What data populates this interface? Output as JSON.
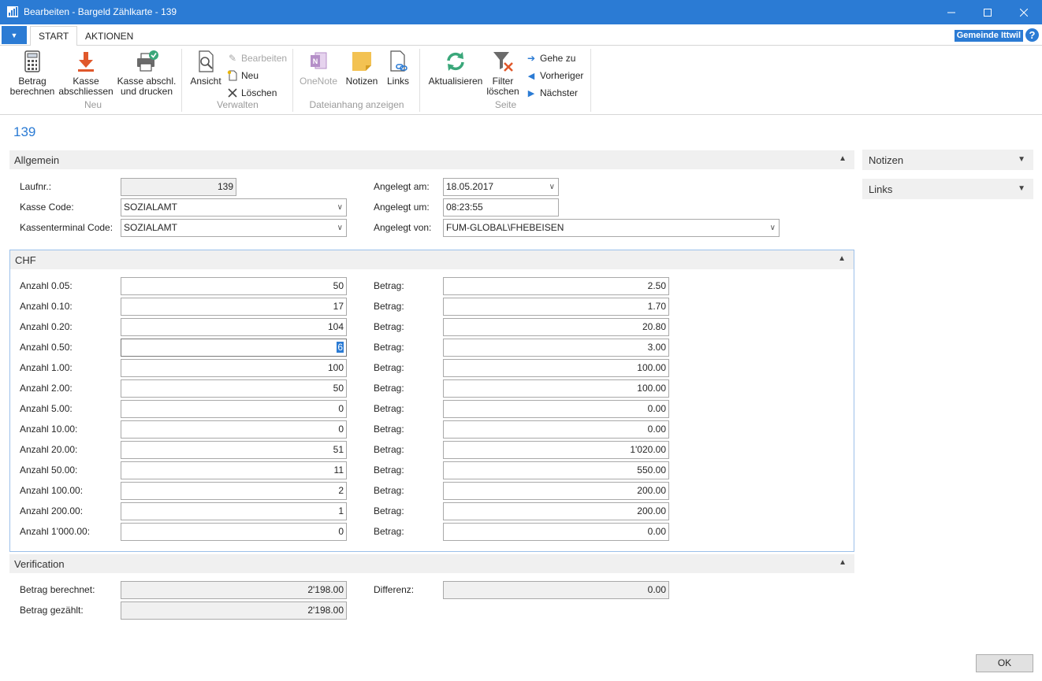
{
  "window": {
    "title": "Bearbeiten - Bargeld Zählkarte - 139"
  },
  "ribbon": {
    "tabs": [
      "START",
      "AKTIONEN"
    ],
    "company": "Gemeinde Ittwil",
    "groups": {
      "neu": {
        "label": "Neu",
        "betrag_berechnen": [
          "Betrag",
          "berechnen"
        ],
        "kasse_abschliessen": [
          "Kasse",
          "abschliessen"
        ],
        "kasse_drucken": [
          "Kasse abschl.",
          "und drucken"
        ]
      },
      "verwalten": {
        "label": "Verwalten",
        "ansicht": "Ansicht",
        "bearbeiten": "Bearbeiten",
        "neu": "Neu",
        "loeschen": "Löschen"
      },
      "dateianhang": {
        "label": "Dateianhang anzeigen",
        "onenote": "OneNote",
        "notizen": "Notizen",
        "links": "Links"
      },
      "seite": {
        "label": "Seite",
        "aktualisieren": "Aktualisieren",
        "filter_loeschen": [
          "Filter",
          "löschen"
        ],
        "gehe_zu": "Gehe zu",
        "vorheriger": "Vorheriger",
        "naechster": "Nächster"
      }
    }
  },
  "page": {
    "title": "139"
  },
  "allgemein": {
    "header": "Allgemein",
    "laufnr_label": "Laufnr.:",
    "laufnr": "139",
    "kasse_code_label": "Kasse Code:",
    "kasse_code": "SOZIALAMT",
    "kassenterminal_label": "Kassenterminal Code:",
    "kassenterminal": "SOZIALAMT",
    "angelegt_am_label": "Angelegt am:",
    "angelegt_am": "18.05.2017",
    "angelegt_um_label": "Angelegt um:",
    "angelegt_um": "08:23:55",
    "angelegt_von_label": "Angelegt von:",
    "angelegt_von": "FUM-GLOBAL\\FHEBEISEN"
  },
  "chf": {
    "header": "CHF",
    "betrag_label": "Betrag:",
    "rows": [
      {
        "label": "Anzahl 0.05:",
        "anzahl": "50",
        "betrag": "2.50"
      },
      {
        "label": "Anzahl 0.10:",
        "anzahl": "17",
        "betrag": "1.70"
      },
      {
        "label": "Anzahl 0.20:",
        "anzahl": "104",
        "betrag": "20.80"
      },
      {
        "label": "Anzahl 0.50:",
        "anzahl": "6",
        "betrag": "3.00"
      },
      {
        "label": "Anzahl 1.00:",
        "anzahl": "100",
        "betrag": "100.00"
      },
      {
        "label": "Anzahl 2.00:",
        "anzahl": "50",
        "betrag": "100.00"
      },
      {
        "label": "Anzahl 5.00:",
        "anzahl": "0",
        "betrag": "0.00"
      },
      {
        "label": "Anzahl 10.00:",
        "anzahl": "0",
        "betrag": "0.00"
      },
      {
        "label": "Anzahl 20.00:",
        "anzahl": "51",
        "betrag": "1'020.00"
      },
      {
        "label": "Anzahl 50.00:",
        "anzahl": "11",
        "betrag": "550.00"
      },
      {
        "label": "Anzahl 100.00:",
        "anzahl": "2",
        "betrag": "200.00"
      },
      {
        "label": "Anzahl 200.00:",
        "anzahl": "1",
        "betrag": "200.00"
      },
      {
        "label": "Anzahl 1'000.00:",
        "anzahl": "0",
        "betrag": "0.00"
      }
    ]
  },
  "verification": {
    "header": "Verification",
    "berechnet_label": "Betrag berechnet:",
    "berechnet": "2'198.00",
    "gezaehlt_label": "Betrag gezählt:",
    "gezaehlt": "2'198.00",
    "differenz_label": "Differenz:",
    "differenz": "0.00"
  },
  "factbox": {
    "notizen": "Notizen",
    "links": "Links"
  },
  "footer": {
    "ok": "OK"
  },
  "colors": {
    "accent": "#2b7bd4",
    "section_bg": "#f0f0f0",
    "focus_border": "#9cc0ea"
  }
}
